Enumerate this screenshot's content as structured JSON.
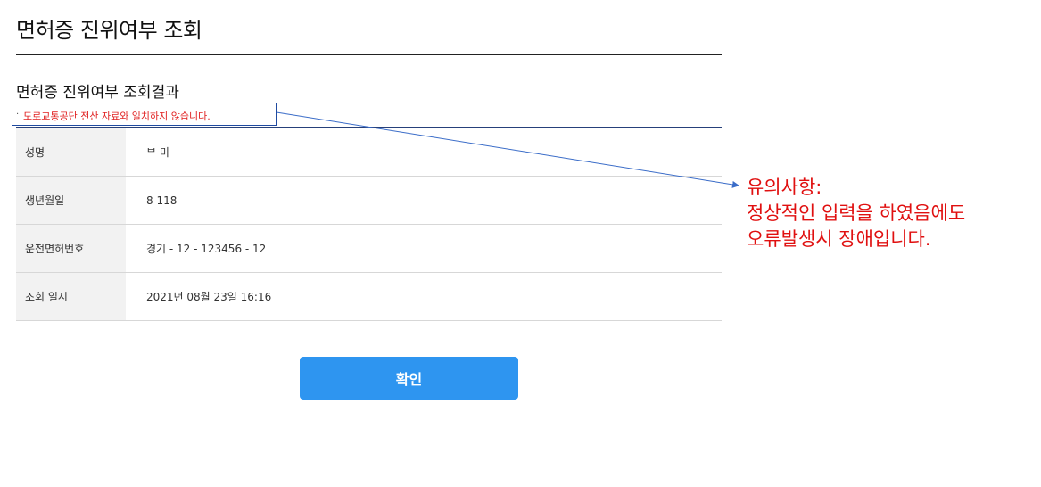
{
  "page": {
    "title": "면허증 진위여부 조회",
    "section_title": "면허증 진위여부 조회결과",
    "error_bullet": "·",
    "error_message": "도로교통공단 전산 자료와 일치하지 않습니다."
  },
  "info_rows": [
    {
      "label": "성명",
      "value": "ᄇ  미"
    },
    {
      "label": "생년월일",
      "value": "8     118"
    },
    {
      "label": "운전면허번호",
      "value": "경기 - 12 - 123456 - 12"
    },
    {
      "label": "조회 일시",
      "value": "2021년 08월 23일 16:16"
    }
  ],
  "confirm_button": {
    "label": "확인"
  },
  "annotation": {
    "line1": "유의사항:",
    "line2": "정상적인 입력을 하였음에도",
    "line3": "오류발생시 장애입니다.",
    "color": "#e01010",
    "arrow_color": "#3a6cc8"
  }
}
